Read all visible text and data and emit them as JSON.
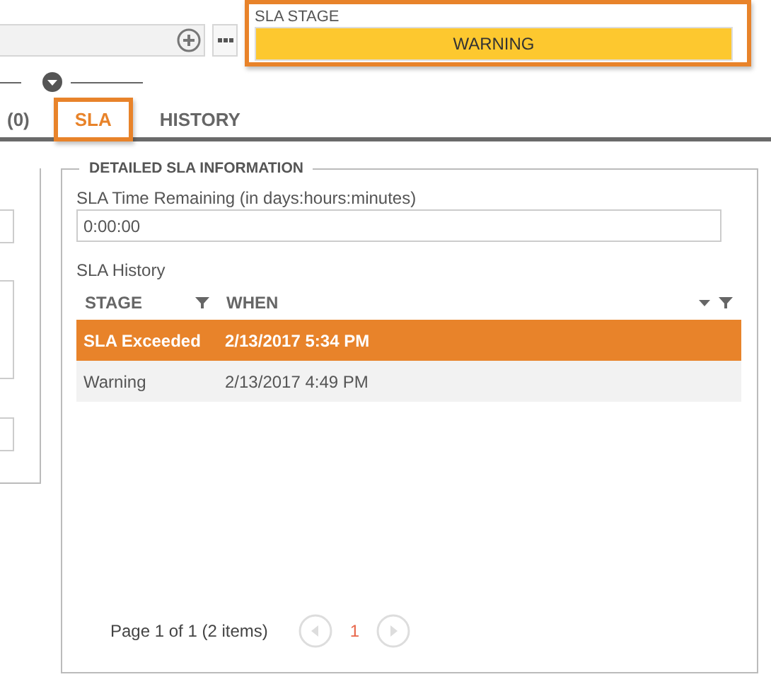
{
  "sla_stage": {
    "label": "SLA STAGE",
    "value": "WARNING"
  },
  "tabs": [
    {
      "label": "(0)",
      "selected": false
    },
    {
      "label": "SLA",
      "selected": true
    },
    {
      "label": "HISTORY",
      "selected": false
    }
  ],
  "details": {
    "legend": "DETAILED SLA INFORMATION",
    "time_remaining": {
      "label": "SLA Time Remaining (in days:hours:minutes)",
      "value": "0:00:00"
    },
    "history": {
      "label": "SLA History",
      "columns": [
        "STAGE",
        "WHEN"
      ],
      "rows": [
        {
          "stage": "SLA Exceeded",
          "when": "2/13/2017 5:34 PM",
          "selected": true
        },
        {
          "stage": "Warning",
          "when": "2/13/2017 4:49 PM",
          "selected": false
        }
      ],
      "pager": {
        "summary": "Page 1 of 1 (2 items)",
        "pages": [
          {
            "label": "1",
            "selected": true
          }
        ]
      }
    }
  }
}
